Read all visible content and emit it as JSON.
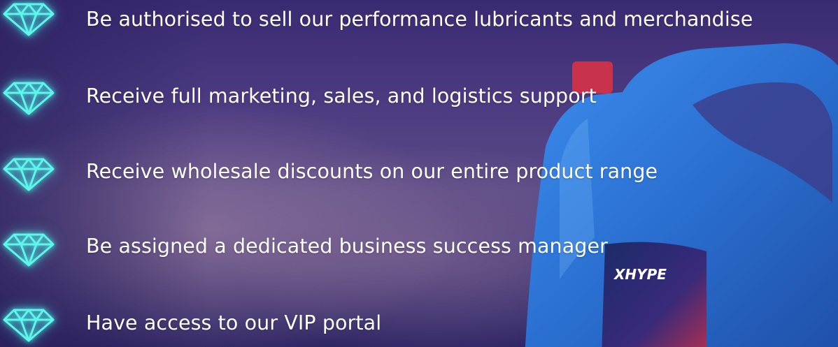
{
  "benefits": {
    "items": [
      {
        "text": "Be authorised to sell our performance lubricants and merchandise",
        "icon": "diamond-icon"
      },
      {
        "text": "Receive full marketing, sales, and logistics support",
        "icon": "diamond-icon"
      },
      {
        "text": "Receive wholesale discounts on our entire product range",
        "icon": "diamond-icon"
      },
      {
        "text": "Be assigned a dedicated business success manager",
        "icon": "diamond-icon"
      },
      {
        "text": "Have access to our VIP portal",
        "icon": "diamond-icon"
      }
    ]
  },
  "product": {
    "brand": "XHYPE"
  },
  "colors": {
    "icon_glow": "#5ef6ea",
    "text": "#ffffff",
    "bottle": "#2f73d6"
  }
}
